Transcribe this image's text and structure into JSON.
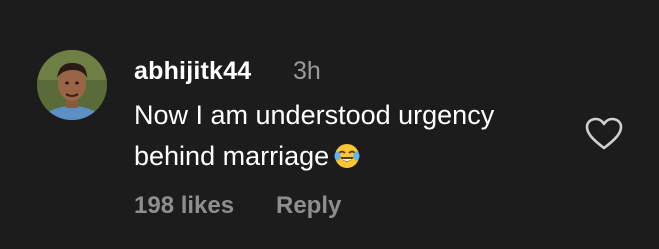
{
  "comment": {
    "username": "abhijitk44",
    "timestamp": "3h",
    "text": "Now I am understood urgency behind marriage",
    "emoji": "laughing-crying-emoji",
    "likes_label": "198 likes",
    "reply_label": "Reply",
    "like_icon": "heart-outline-icon"
  },
  "colors": {
    "background": "#1c1c1c",
    "username": "#ffffff",
    "timestamp": "#9a9a9a",
    "meta": "#8e8e8e",
    "emoji_face": "#f7c631"
  }
}
